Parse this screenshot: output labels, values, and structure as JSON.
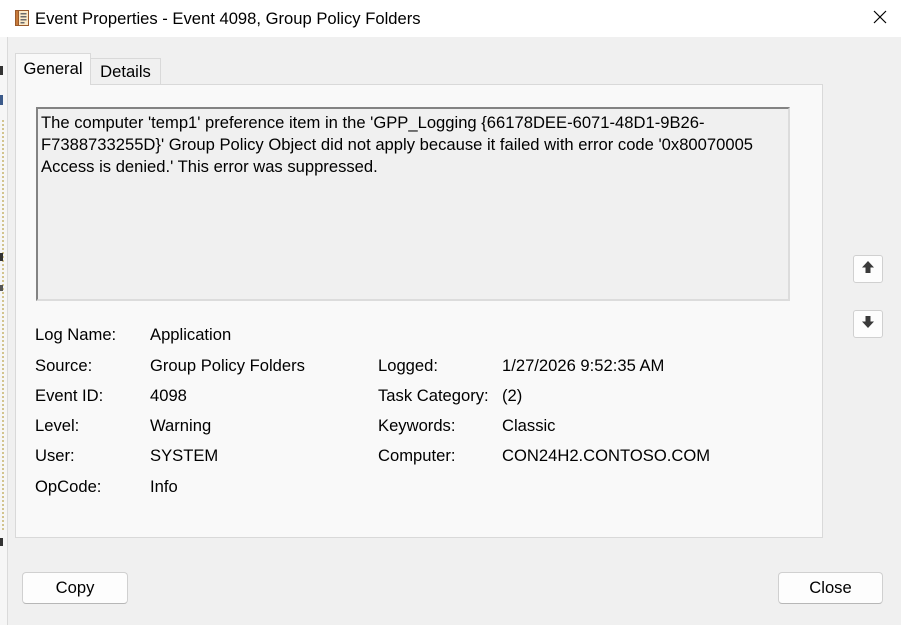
{
  "window": {
    "title": "Event Properties - Event 4098, Group Policy Folders",
    "icon": "event-viewer-icon",
    "close_icon": "close-icon"
  },
  "tabs": [
    {
      "label": "General",
      "selected": true
    },
    {
      "label": "Details",
      "selected": false
    }
  ],
  "general": {
    "message_lines": [
      "The computer 'temp1' preference item in the 'GPP_Logging {66178DEE-6071-48D1-9B26-",
      "F7388733255D}' Group Policy Object did not apply because it failed with error code '0x80070005",
      "Access is denied.' This error was suppressed."
    ],
    "fields": {
      "log_name": {
        "label": "Log Name:",
        "value": "Application"
      },
      "source": {
        "label": "Source:",
        "value": "Group Policy Folders"
      },
      "logged": {
        "label": "Logged:",
        "value": "1/27/2026 9:52:35 AM"
      },
      "event_id": {
        "label": "Event ID:",
        "value": "4098"
      },
      "task_category": {
        "label": "Task Category:",
        "value": "(2)"
      },
      "level": {
        "label": "Level:",
        "value": "Warning"
      },
      "keywords": {
        "label": "Keywords:",
        "value": "Classic"
      },
      "user": {
        "label": "User:",
        "value": "SYSTEM"
      },
      "computer": {
        "label": "Computer:",
        "value": "CON24H2.CONTOSO.COM"
      },
      "opcode": {
        "label": "OpCode:",
        "value": "Info"
      }
    }
  },
  "navigation": {
    "previous_icon": "arrow-up-icon",
    "next_icon": "arrow-down-icon"
  },
  "buttons": {
    "copy": "Copy",
    "close": "Close"
  },
  "theme": {
    "titlebar_bg": "#ffffff",
    "dialog_bg": "#f0f0f0",
    "panel_bg": "#f9f9f9",
    "border": "#d9d9d9",
    "text": "#000000"
  }
}
